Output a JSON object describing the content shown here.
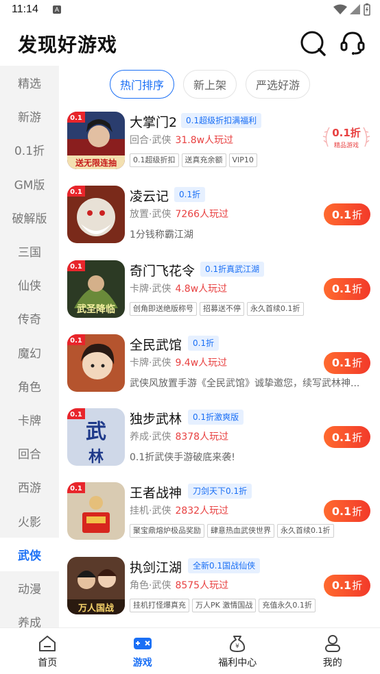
{
  "status_bar": {
    "time": "11:14",
    "notification": "A"
  },
  "header": {
    "title": "发现好游戏"
  },
  "sidebar": {
    "items": [
      {
        "label": "精选"
      },
      {
        "label": "新游"
      },
      {
        "label": "0.1折"
      },
      {
        "label": "GM版"
      },
      {
        "label": "破解版"
      },
      {
        "label": "三国"
      },
      {
        "label": "仙侠"
      },
      {
        "label": "传奇"
      },
      {
        "label": "魔幻"
      },
      {
        "label": "角色"
      },
      {
        "label": "卡牌"
      },
      {
        "label": "回合"
      },
      {
        "label": "西游"
      },
      {
        "label": "火影"
      },
      {
        "label": "武侠"
      },
      {
        "label": "动漫"
      },
      {
        "label": "养成"
      }
    ],
    "active": "武侠"
  },
  "tabs": [
    {
      "label": "热门排序"
    },
    {
      "label": "新上架"
    },
    {
      "label": "严选好游"
    }
  ],
  "games": [
    {
      "name": "大掌门2",
      "tag": "0.1超级折扣满福利",
      "genre": "回合·武侠",
      "players": "31.8w人玩过",
      "labels": [
        "0.1超级折扣",
        "送真充余额",
        "VIP10"
      ],
      "badge": "0.1折",
      "seal_sub": "精品游戏",
      "icon_text": "送无限连抽",
      "icon_color": "#8a1e1e"
    },
    {
      "name": "凌云记",
      "tag": "0.1折",
      "genre": "放置·武侠",
      "players": "7266人玩过",
      "desc": "1分钱称霸江湖",
      "badge": "0.1",
      "badge_unit": "折",
      "icon_color": "#7a2a1a"
    },
    {
      "name": "奇门飞花令",
      "tag": "0.1折真武江湖",
      "genre": "卡牌·武侠",
      "players": "4.8w人玩过",
      "labels": [
        "创角即送绝版称号",
        "招募送不停",
        "永久首续0.1折"
      ],
      "badge": "0.1",
      "badge_unit": "折",
      "icon_text": "武圣降临",
      "icon_color": "#2c3a24"
    },
    {
      "name": "全民武馆",
      "tag": "0.1折",
      "genre": "卡牌·武侠",
      "players": "9.4w人玩过",
      "desc": "武侠风放置手游《全民武馆》诚挚邀您，续写武林神...",
      "badge": "0.1",
      "badge_unit": "折",
      "icon_color": "#b5542e"
    },
    {
      "name": "独步武林",
      "tag": "0.1折激爽版",
      "genre": "养成·武侠",
      "players": "8378人玩过",
      "desc": "0.1折武侠手游破底来袭!",
      "badge": "0.1",
      "badge_unit": "折",
      "icon_text": "武林",
      "icon_color": "#cfd8e8"
    },
    {
      "name": "王者战神",
      "tag": "刀剑天下0.1折",
      "genre": "挂机·武侠",
      "players": "2832人玩过",
      "labels": [
        "聚宝鼎熔炉极品奖励",
        "肆意热血武侠世界",
        "永久首续0.1折"
      ],
      "badge": "0.1",
      "badge_unit": "折",
      "icon_color": "#d9cbb2"
    },
    {
      "name": "执剑江湖",
      "tag": "全新0.1国战仙侠",
      "genre": "角色·武侠",
      "players": "8575人玩过",
      "labels": [
        "挂机打怪爆真充",
        "万人PK 激情国战",
        "充值永久0.1折"
      ],
      "badge": "0.1",
      "badge_unit": "折",
      "icon_text": "万人国战",
      "icon_color": "#5a3a2a"
    }
  ],
  "bottom_nav": [
    {
      "label": "首页",
      "icon": "home-icon"
    },
    {
      "label": "游戏",
      "icon": "gamepad-icon"
    },
    {
      "label": "福利中心",
      "icon": "money-bag-icon"
    },
    {
      "label": "我的",
      "icon": "user-icon"
    }
  ],
  "colors": {
    "accent": "#1a6ff5",
    "price": "#e84141",
    "badge": "#f23a2a"
  }
}
